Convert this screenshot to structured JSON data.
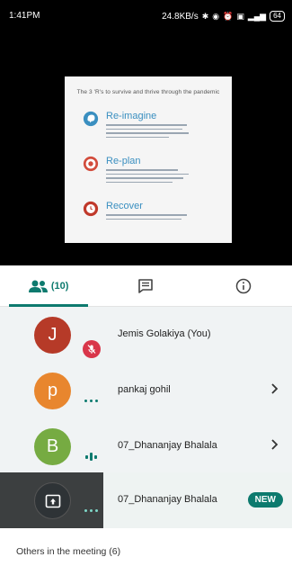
{
  "status_bar": {
    "time": "1:41PM",
    "speed": "24.8KB/s",
    "battery": "64"
  },
  "slide": {
    "title": "The 3 'R's to survive and thrive through the pandemic",
    "items": [
      {
        "heading": "Re-imagine",
        "color": "#3a8fc0",
        "icon": "brain-icon"
      },
      {
        "heading": "Re-plan",
        "color": "#d24c3c",
        "icon": "target-icon"
      },
      {
        "heading": "Recover",
        "color": "#c0392b",
        "icon": "clock-icon"
      }
    ]
  },
  "tabs": {
    "people_count": "(10)",
    "people_icon": "people-icon",
    "chat_icon": "chat-icon",
    "info_icon": "info-icon"
  },
  "participants": [
    {
      "initial": "J",
      "name": "Jemis Golakiya (You)",
      "avatar_color": "#b63a28",
      "status": "muted"
    },
    {
      "initial": "p",
      "name": "pankaj gohil",
      "avatar_color": "#e8862e",
      "status": "more"
    },
    {
      "initial": "B",
      "name": "07_Dhananjay Bhalala",
      "avatar_color": "#76ab42",
      "status": "speaking"
    },
    {
      "initial": "",
      "name": "07_Dhananjay Bhalala",
      "avatar_color": "#2e3336",
      "status": "presenting",
      "badge": "NEW"
    }
  ],
  "others_label": "Others in the meeting (6)",
  "colors": {
    "accent": "#0d7a6e",
    "mute": "#d9364a"
  }
}
